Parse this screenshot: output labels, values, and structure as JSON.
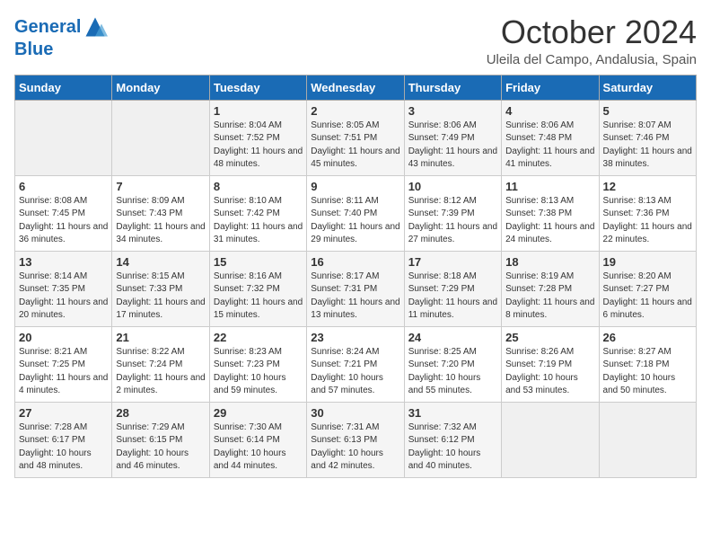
{
  "header": {
    "logo_line1": "General",
    "logo_line2": "Blue",
    "month": "October 2024",
    "location": "Uleila del Campo, Andalusia, Spain"
  },
  "weekdays": [
    "Sunday",
    "Monday",
    "Tuesday",
    "Wednesday",
    "Thursday",
    "Friday",
    "Saturday"
  ],
  "weeks": [
    [
      {
        "day": "",
        "empty": true
      },
      {
        "day": "",
        "empty": true
      },
      {
        "day": "1",
        "sunrise": "Sunrise: 8:04 AM",
        "sunset": "Sunset: 7:52 PM",
        "daylight": "Daylight: 11 hours and 48 minutes."
      },
      {
        "day": "2",
        "sunrise": "Sunrise: 8:05 AM",
        "sunset": "Sunset: 7:51 PM",
        "daylight": "Daylight: 11 hours and 45 minutes."
      },
      {
        "day": "3",
        "sunrise": "Sunrise: 8:06 AM",
        "sunset": "Sunset: 7:49 PM",
        "daylight": "Daylight: 11 hours and 43 minutes."
      },
      {
        "day": "4",
        "sunrise": "Sunrise: 8:06 AM",
        "sunset": "Sunset: 7:48 PM",
        "daylight": "Daylight: 11 hours and 41 minutes."
      },
      {
        "day": "5",
        "sunrise": "Sunrise: 8:07 AM",
        "sunset": "Sunset: 7:46 PM",
        "daylight": "Daylight: 11 hours and 38 minutes."
      }
    ],
    [
      {
        "day": "6",
        "sunrise": "Sunrise: 8:08 AM",
        "sunset": "Sunset: 7:45 PM",
        "daylight": "Daylight: 11 hours and 36 minutes."
      },
      {
        "day": "7",
        "sunrise": "Sunrise: 8:09 AM",
        "sunset": "Sunset: 7:43 PM",
        "daylight": "Daylight: 11 hours and 34 minutes."
      },
      {
        "day": "8",
        "sunrise": "Sunrise: 8:10 AM",
        "sunset": "Sunset: 7:42 PM",
        "daylight": "Daylight: 11 hours and 31 minutes."
      },
      {
        "day": "9",
        "sunrise": "Sunrise: 8:11 AM",
        "sunset": "Sunset: 7:40 PM",
        "daylight": "Daylight: 11 hours and 29 minutes."
      },
      {
        "day": "10",
        "sunrise": "Sunrise: 8:12 AM",
        "sunset": "Sunset: 7:39 PM",
        "daylight": "Daylight: 11 hours and 27 minutes."
      },
      {
        "day": "11",
        "sunrise": "Sunrise: 8:13 AM",
        "sunset": "Sunset: 7:38 PM",
        "daylight": "Daylight: 11 hours and 24 minutes."
      },
      {
        "day": "12",
        "sunrise": "Sunrise: 8:13 AM",
        "sunset": "Sunset: 7:36 PM",
        "daylight": "Daylight: 11 hours and 22 minutes."
      }
    ],
    [
      {
        "day": "13",
        "sunrise": "Sunrise: 8:14 AM",
        "sunset": "Sunset: 7:35 PM",
        "daylight": "Daylight: 11 hours and 20 minutes."
      },
      {
        "day": "14",
        "sunrise": "Sunrise: 8:15 AM",
        "sunset": "Sunset: 7:33 PM",
        "daylight": "Daylight: 11 hours and 17 minutes."
      },
      {
        "day": "15",
        "sunrise": "Sunrise: 8:16 AM",
        "sunset": "Sunset: 7:32 PM",
        "daylight": "Daylight: 11 hours and 15 minutes."
      },
      {
        "day": "16",
        "sunrise": "Sunrise: 8:17 AM",
        "sunset": "Sunset: 7:31 PM",
        "daylight": "Daylight: 11 hours and 13 minutes."
      },
      {
        "day": "17",
        "sunrise": "Sunrise: 8:18 AM",
        "sunset": "Sunset: 7:29 PM",
        "daylight": "Daylight: 11 hours and 11 minutes."
      },
      {
        "day": "18",
        "sunrise": "Sunrise: 8:19 AM",
        "sunset": "Sunset: 7:28 PM",
        "daylight": "Daylight: 11 hours and 8 minutes."
      },
      {
        "day": "19",
        "sunrise": "Sunrise: 8:20 AM",
        "sunset": "Sunset: 7:27 PM",
        "daylight": "Daylight: 11 hours and 6 minutes."
      }
    ],
    [
      {
        "day": "20",
        "sunrise": "Sunrise: 8:21 AM",
        "sunset": "Sunset: 7:25 PM",
        "daylight": "Daylight: 11 hours and 4 minutes."
      },
      {
        "day": "21",
        "sunrise": "Sunrise: 8:22 AM",
        "sunset": "Sunset: 7:24 PM",
        "daylight": "Daylight: 11 hours and 2 minutes."
      },
      {
        "day": "22",
        "sunrise": "Sunrise: 8:23 AM",
        "sunset": "Sunset: 7:23 PM",
        "daylight": "Daylight: 10 hours and 59 minutes."
      },
      {
        "day": "23",
        "sunrise": "Sunrise: 8:24 AM",
        "sunset": "Sunset: 7:21 PM",
        "daylight": "Daylight: 10 hours and 57 minutes."
      },
      {
        "day": "24",
        "sunrise": "Sunrise: 8:25 AM",
        "sunset": "Sunset: 7:20 PM",
        "daylight": "Daylight: 10 hours and 55 minutes."
      },
      {
        "day": "25",
        "sunrise": "Sunrise: 8:26 AM",
        "sunset": "Sunset: 7:19 PM",
        "daylight": "Daylight: 10 hours and 53 minutes."
      },
      {
        "day": "26",
        "sunrise": "Sunrise: 8:27 AM",
        "sunset": "Sunset: 7:18 PM",
        "daylight": "Daylight: 10 hours and 50 minutes."
      }
    ],
    [
      {
        "day": "27",
        "sunrise": "Sunrise: 7:28 AM",
        "sunset": "Sunset: 6:17 PM",
        "daylight": "Daylight: 10 hours and 48 minutes."
      },
      {
        "day": "28",
        "sunrise": "Sunrise: 7:29 AM",
        "sunset": "Sunset: 6:15 PM",
        "daylight": "Daylight: 10 hours and 46 minutes."
      },
      {
        "day": "29",
        "sunrise": "Sunrise: 7:30 AM",
        "sunset": "Sunset: 6:14 PM",
        "daylight": "Daylight: 10 hours and 44 minutes."
      },
      {
        "day": "30",
        "sunrise": "Sunrise: 7:31 AM",
        "sunset": "Sunset: 6:13 PM",
        "daylight": "Daylight: 10 hours and 42 minutes."
      },
      {
        "day": "31",
        "sunrise": "Sunrise: 7:32 AM",
        "sunset": "Sunset: 6:12 PM",
        "daylight": "Daylight: 10 hours and 40 minutes."
      },
      {
        "day": "",
        "empty": true
      },
      {
        "day": "",
        "empty": true
      }
    ]
  ]
}
